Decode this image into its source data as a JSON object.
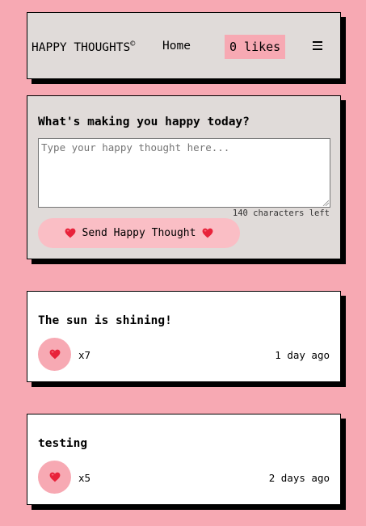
{
  "nav": {
    "brand": "HAPPY THOUGHTS",
    "brand_mark": "©",
    "home": "Home",
    "likes_badge": "0 likes",
    "menu_icon": "hamburger-menu-icon"
  },
  "compose": {
    "title": "What's making you happy today?",
    "input_value": "",
    "input_placeholder": "Type your happy thought here...",
    "char_count": "140 characters left",
    "send_label": "Send Happy Thought",
    "send_icon": "heart-icon"
  },
  "posts": [
    {
      "text": "The sun is shining!",
      "likes": "x7",
      "time": "1 day ago",
      "icon": "heart-icon"
    },
    {
      "text": "testing",
      "likes": "x5",
      "time": "2 days ago",
      "icon": "heart-icon"
    }
  ],
  "colors": {
    "background": "#f7a9b3",
    "card_grey": "#e0dbd9",
    "button_pink": "#fabec5",
    "heart_red": "#e8223a",
    "shadow": "#000000"
  }
}
